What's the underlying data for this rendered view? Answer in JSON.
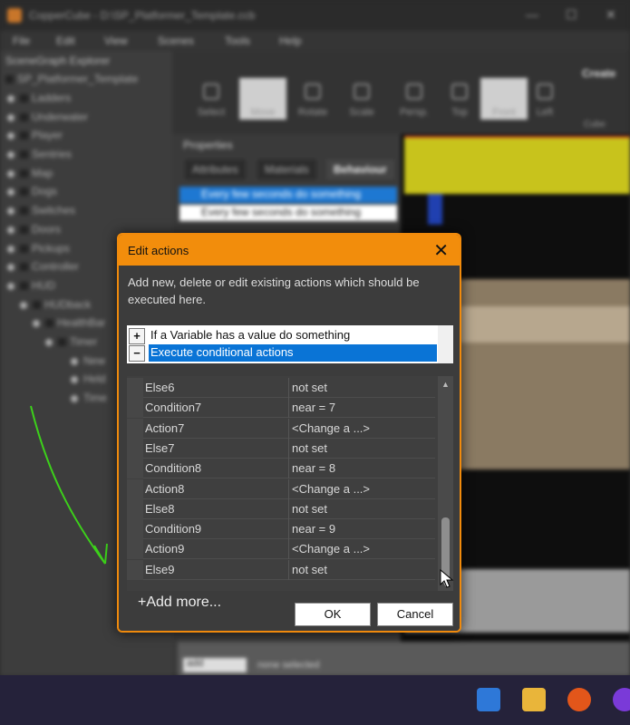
{
  "app": {
    "window_title": "CopperCube - D:\\SP_Platformer_Template.ccb",
    "menu": [
      "File",
      "Edit",
      "View",
      "Scenes",
      "Tools",
      "Help"
    ],
    "scenegraph": {
      "title": "SceneGraph Explorer",
      "items": [
        "SP_Platformer_Template",
        "Ladders",
        "Underwater",
        "Player",
        "Sentries",
        "Map",
        "Dogs",
        "Switches",
        "Doors",
        "Pickups",
        "Controller",
        "HUD",
        "HUDback",
        "HealthBar",
        "Timer",
        "New",
        "Held",
        "Time"
      ]
    },
    "toolbar": {
      "tools": [
        "Select",
        "Move",
        "Rotate",
        "Scale",
        "Persp.",
        "Top",
        "Front",
        "Left"
      ],
      "create_label": "Create",
      "create_sub": "Cube"
    },
    "properties": {
      "title": "Properties",
      "tabs": [
        "Attributes",
        "Materials",
        "Behaviour"
      ],
      "behaviours": [
        "Every few seconds do something",
        "Every few seconds do something"
      ]
    },
    "status": {
      "field": "add",
      "text": "none selected"
    }
  },
  "dialog": {
    "title": "Edit actions",
    "close_glyph": "✕",
    "description": "Add new, delete or edit existing actions which should be executed here.",
    "actions": [
      {
        "button": "+",
        "label": "If a Variable has a value do something",
        "selected": false
      },
      {
        "button": "−",
        "label": "Execute conditional actions",
        "selected": true
      }
    ],
    "properties": [
      {
        "name": "Else6",
        "value": "not set"
      },
      {
        "name": "Condition7",
        "value": "near = 7"
      },
      {
        "name": "Action7",
        "value": "<Change a ...>"
      },
      {
        "name": "Else7",
        "value": "not set"
      },
      {
        "name": "Condition8",
        "value": "near = 8"
      },
      {
        "name": "Action8",
        "value": "<Change a ...>"
      },
      {
        "name": "Else8",
        "value": "not set"
      },
      {
        "name": "Condition9",
        "value": "near = 9"
      },
      {
        "name": "Action9",
        "value": "<Change a ...>"
      },
      {
        "name": "Else9",
        "value": "not set"
      }
    ],
    "add_more_label": "+Add more...",
    "ok_label": "OK",
    "cancel_label": "Cancel"
  },
  "colors": {
    "dialog_accent": "#f28d0c",
    "selection": "#0a74d6",
    "annotation_arrow": "#3cd11a"
  },
  "icons": {
    "scroll_up": "▲",
    "scroll_down": "▼"
  }
}
